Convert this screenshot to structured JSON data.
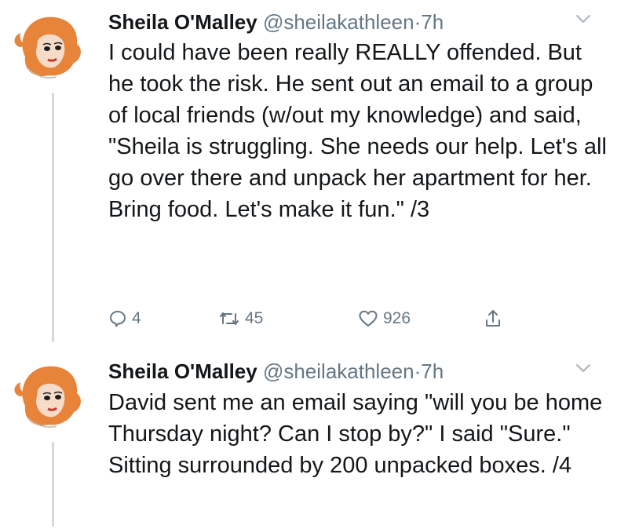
{
  "tweets": [
    {
      "name": "Sheila O'Malley",
      "handle": "@sheilakathleen",
      "separator": "·",
      "time": "7h",
      "text": "I could have been really REALLY offended. But he took the risk. He sent out an email to a group of local friends (w/out my knowledge) and said, \"Sheila is struggling. She needs our help. Let's all go over there and unpack her apartment for her. Bring food. Let's make it fun.\" /3",
      "replies": "4",
      "retweets": "45",
      "likes": "926"
    },
    {
      "name": "Sheila O'Malley",
      "handle": "@sheilakathleen",
      "separator": "·",
      "time": "7h",
      "text": "David sent me an email saying \"will you be home Thursday night? Can I stop by?\" I said \"Sure.\" Sitting surrounded by 200 unpacked boxes. /4"
    }
  ],
  "icons": {
    "avatar": "illustrated-portrait-avatar",
    "menu": "chevron-down-icon",
    "reply": "reply-icon",
    "retweet": "retweet-icon",
    "like": "heart-icon",
    "share": "share-icon"
  },
  "colors": {
    "text": "#14171a",
    "muted": "#657786",
    "thread_line": "#d4d9dd",
    "hair": "#e8833a"
  }
}
